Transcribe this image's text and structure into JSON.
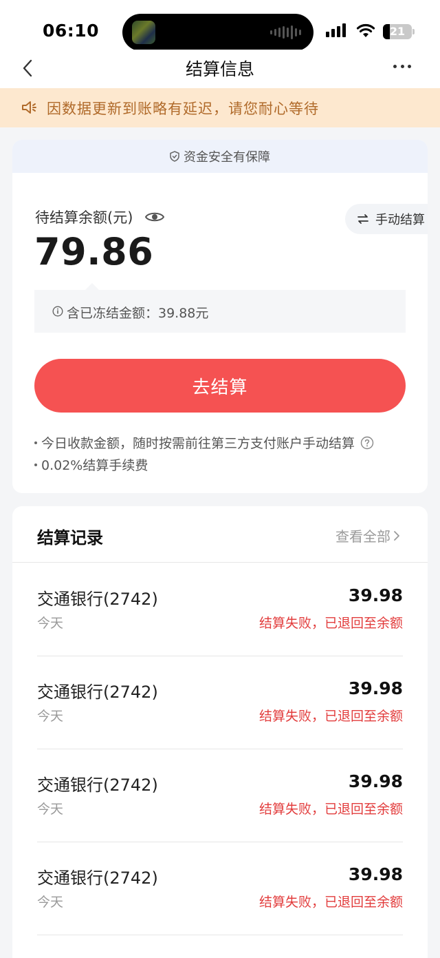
{
  "status_bar": {
    "time": "06:10",
    "battery": "21"
  },
  "nav": {
    "title": "结算信息"
  },
  "notice": {
    "text": "因数据更新到账略有延迟，请您耐心等待"
  },
  "balance_card": {
    "secure_text": "资金安全有保障",
    "label": "待结算余额(元)",
    "amount": "79.86",
    "manual_settle_label": "手动结算",
    "frozen_text": "含已冻结金额：39.88元",
    "settle_button": "去结算",
    "tips": [
      "今日收款金额，随时按需前往第三方支付账户手动结算",
      "0.02%结算手续费"
    ]
  },
  "records": {
    "title": "结算记录",
    "view_all": "查看全部",
    "items": [
      {
        "bank": "交通银行(2742)",
        "date": "今天",
        "amount": "39.98",
        "status": "结算失败，已退回至余额"
      },
      {
        "bank": "交通银行(2742)",
        "date": "今天",
        "amount": "39.98",
        "status": "结算失败，已退回至余额"
      },
      {
        "bank": "交通银行(2742)",
        "date": "今天",
        "amount": "39.98",
        "status": "结算失败，已退回至余额"
      },
      {
        "bank": "交通银行(2742)",
        "date": "今天",
        "amount": "39.98",
        "status": "结算失败，已退回至余额"
      }
    ]
  },
  "colors": {
    "accent": "#f55252",
    "notice_bg": "#fde8cf",
    "notice_text": "#b06a2a",
    "error": "#e23c3c"
  }
}
